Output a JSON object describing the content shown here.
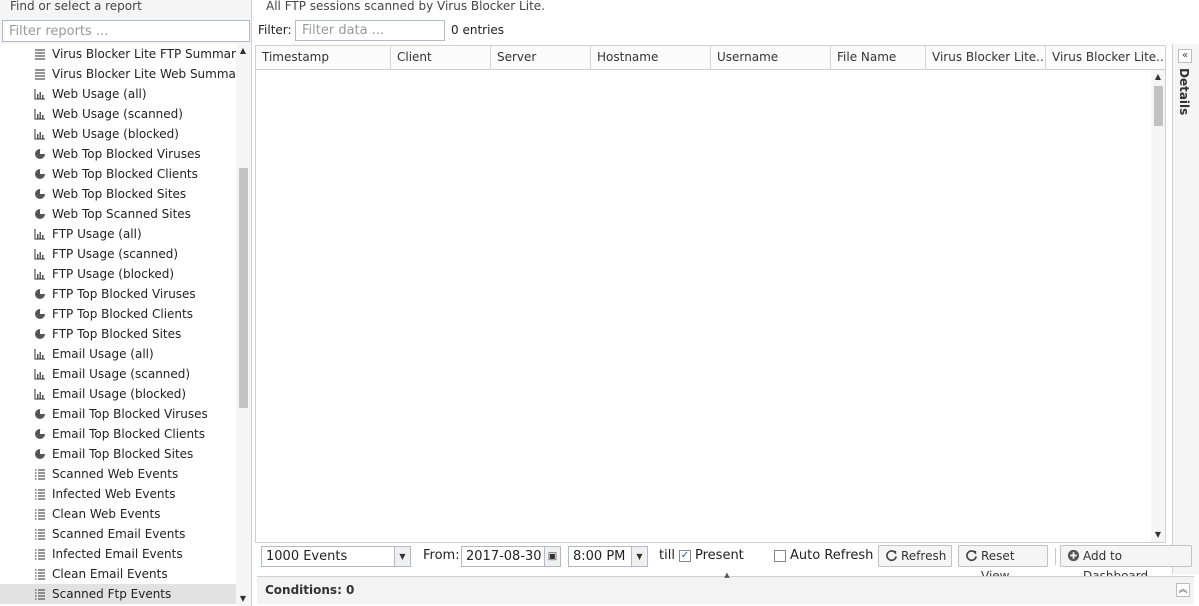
{
  "left_panel": {
    "title": "Find or select a report",
    "filter_placeholder": "Filter reports ...",
    "items": [
      {
        "label": "Virus Blocker Lite FTP Summary",
        "icon": "summary-icon"
      },
      {
        "label": "Virus Blocker Lite Web Summary",
        "icon": "summary-icon"
      },
      {
        "label": "Web Usage (all)",
        "icon": "bar-chart-icon"
      },
      {
        "label": "Web Usage (scanned)",
        "icon": "bar-chart-icon"
      },
      {
        "label": "Web Usage (blocked)",
        "icon": "bar-chart-icon"
      },
      {
        "label": "Web Top Blocked Viruses",
        "icon": "pie-chart-icon"
      },
      {
        "label": "Web Top Blocked Clients",
        "icon": "pie-chart-icon"
      },
      {
        "label": "Web Top Blocked Sites",
        "icon": "pie-chart-icon"
      },
      {
        "label": "Web Top Scanned Sites",
        "icon": "pie-chart-icon"
      },
      {
        "label": "FTP Usage (all)",
        "icon": "bar-chart-icon"
      },
      {
        "label": "FTP Usage (scanned)",
        "icon": "bar-chart-icon"
      },
      {
        "label": "FTP Usage (blocked)",
        "icon": "bar-chart-icon"
      },
      {
        "label": "FTP Top Blocked Viruses",
        "icon": "pie-chart-icon"
      },
      {
        "label": "FTP Top Blocked Clients",
        "icon": "pie-chart-icon"
      },
      {
        "label": "FTP Top Blocked Sites",
        "icon": "pie-chart-icon"
      },
      {
        "label": "Email Usage (all)",
        "icon": "bar-chart-icon"
      },
      {
        "label": "Email Usage (scanned)",
        "icon": "bar-chart-icon"
      },
      {
        "label": "Email Usage (blocked)",
        "icon": "bar-chart-icon"
      },
      {
        "label": "Email Top Blocked Viruses",
        "icon": "pie-chart-icon"
      },
      {
        "label": "Email Top Blocked Clients",
        "icon": "pie-chart-icon"
      },
      {
        "label": "Email Top Blocked Sites",
        "icon": "pie-chart-icon"
      },
      {
        "label": "Scanned Web Events",
        "icon": "list-icon"
      },
      {
        "label": "Infected Web Events",
        "icon": "list-icon"
      },
      {
        "label": "Clean Web Events",
        "icon": "list-icon"
      },
      {
        "label": "Scanned Email Events",
        "icon": "list-icon"
      },
      {
        "label": "Infected Email Events",
        "icon": "list-icon"
      },
      {
        "label": "Clean Email Events",
        "icon": "list-icon"
      },
      {
        "label": "Scanned Ftp Events",
        "icon": "list-icon",
        "selected": true
      }
    ]
  },
  "main": {
    "description": "All FTP sessions scanned by Virus Blocker Lite.",
    "filter_label": "Filter:",
    "filter_placeholder": "Filter data ...",
    "entries": "0 entries",
    "columns": [
      "Timestamp",
      "Client",
      "Server",
      "Hostname",
      "Username",
      "File Name",
      "Virus Blocker Lite...",
      "Virus Blocker Lite..."
    ]
  },
  "details": {
    "label": "Details"
  },
  "toolbar": {
    "events_value": "1000 Events",
    "from_label": "From:",
    "date_value": "2017-08-30",
    "time_value": "8:00 PM",
    "till_label": "till",
    "present_label": "Present",
    "present_checked": true,
    "auto_refresh_label": "Auto Refresh",
    "auto_refresh_checked": false,
    "refresh_label": "Refresh",
    "reset_view_label": "Reset View",
    "add_dashboard_label": "Add to Dashboard"
  },
  "conditions": {
    "title": "Conditions: 0"
  }
}
